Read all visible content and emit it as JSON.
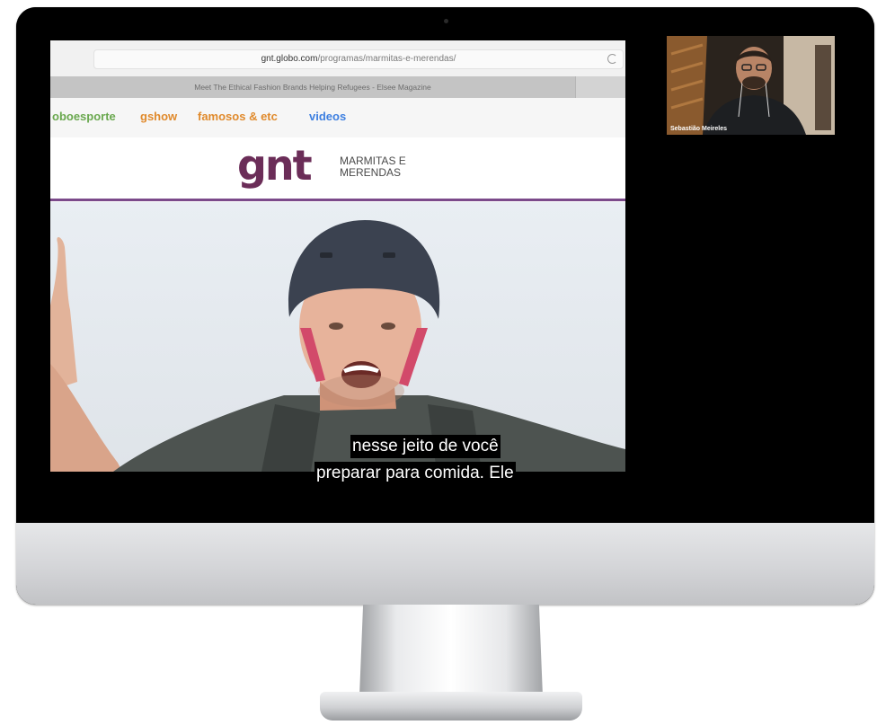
{
  "browser": {
    "url_host": "gnt.globo.com",
    "url_path": "/programas/marmitas-e-merendas/",
    "tab_title": "Meet The Ethical Fashion Brands Helping Refugees - Elsee Magazine"
  },
  "site_nav": {
    "items": [
      "oboesporte",
      "gshow",
      "famosos & etc",
      "videos"
    ]
  },
  "brand": {
    "logo_text": "gnt",
    "program_name_line1": "MARMITAS E",
    "program_name_line2": "MERENDAS"
  },
  "subtitles": {
    "line1": "nesse jeito de você",
    "line2": "preparar para comida. Ele"
  },
  "participant": {
    "name": "Sebastião Meireles"
  },
  "colors": {
    "gnt_purple": "#6b2d58",
    "nav_green": "#6aa84f",
    "nav_orange": "#e08a2c",
    "nav_blue": "#3d7fe0",
    "divider_purple": "#7b4a8a"
  }
}
